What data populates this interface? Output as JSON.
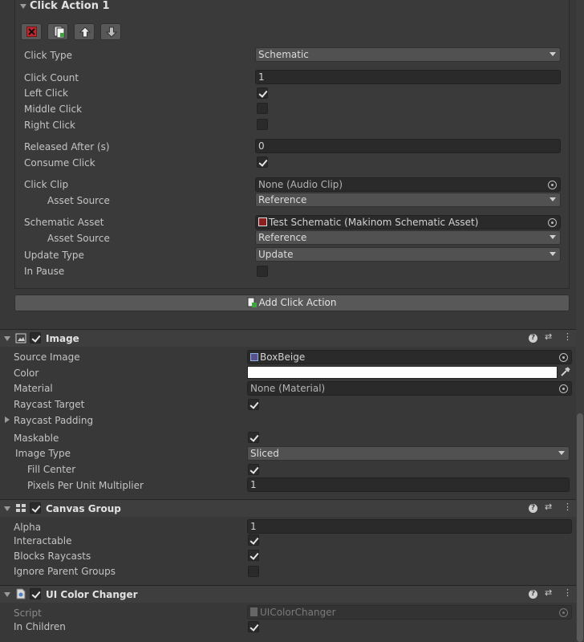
{
  "click_action": {
    "title": "Click Action 1",
    "rows": {
      "click_type": {
        "label": "Click Type",
        "value": "Schematic"
      },
      "click_count": {
        "label": "Click Count",
        "value": "1"
      },
      "left_click": {
        "label": "Left Click",
        "checked": true
      },
      "middle_click": {
        "label": "Middle Click",
        "checked": false
      },
      "right_click": {
        "label": "Right Click",
        "checked": false
      },
      "released_after": {
        "label": "Released After (s)",
        "value": "0"
      },
      "consume_click": {
        "label": "Consume Click",
        "checked": true
      },
      "click_clip": {
        "label": "Click Clip",
        "value": "None (Audio Clip)"
      },
      "clip_asset_source": {
        "label": "Asset Source",
        "value": "Reference"
      },
      "schematic_asset": {
        "label": "Schematic Asset",
        "value": "Test Schematic (Makinom Schematic Asset)"
      },
      "schematic_asset_source": {
        "label": "Asset Source",
        "value": "Reference"
      },
      "update_type": {
        "label": "Update Type",
        "value": "Update"
      },
      "in_pause": {
        "label": "In Pause",
        "checked": false
      }
    },
    "add_button": "Add Click Action"
  },
  "image": {
    "title": "Image",
    "enabled": true,
    "rows": {
      "source_image": {
        "label": "Source Image",
        "value": "BoxBeige"
      },
      "color": {
        "label": "Color",
        "value": "#ffffff"
      },
      "material": {
        "label": "Material",
        "value": "None (Material)"
      },
      "raycast_target": {
        "label": "Raycast Target",
        "checked": true
      },
      "raycast_padding": {
        "label": "Raycast Padding"
      },
      "maskable": {
        "label": "Maskable",
        "checked": true
      },
      "image_type": {
        "label": "Image Type",
        "value": "Sliced"
      },
      "fill_center": {
        "label": "Fill Center",
        "checked": true
      },
      "ppu_multiplier": {
        "label": "Pixels Per Unit Multiplier",
        "value": "1"
      }
    }
  },
  "canvas_group": {
    "title": "Canvas Group",
    "enabled": true,
    "rows": {
      "alpha": {
        "label": "Alpha",
        "value": "1"
      },
      "interactable": {
        "label": "Interactable",
        "checked": true
      },
      "blocks_raycasts": {
        "label": "Blocks Raycasts",
        "checked": true
      },
      "ignore_parent_groups": {
        "label": "Ignore Parent Groups",
        "checked": false
      }
    }
  },
  "ui_color_changer": {
    "title": "UI Color Changer",
    "enabled": true,
    "rows": {
      "script": {
        "label": "Script",
        "value": "UIColorChanger"
      },
      "in_children": {
        "label": "In Children",
        "checked": true
      }
    }
  },
  "icons": [
    "remove-icon",
    "copy-icon",
    "move-up-icon",
    "move-down-icon",
    "help-icon",
    "preset-icon",
    "kebab-menu-icon",
    "object-picker-icon",
    "eyedropper-icon"
  ],
  "colors": {
    "panel": "#383838",
    "field": "#2a2a2a",
    "dropdown": "#515151",
    "header": "#3e3e3e",
    "remove_red": "#c0282d"
  }
}
